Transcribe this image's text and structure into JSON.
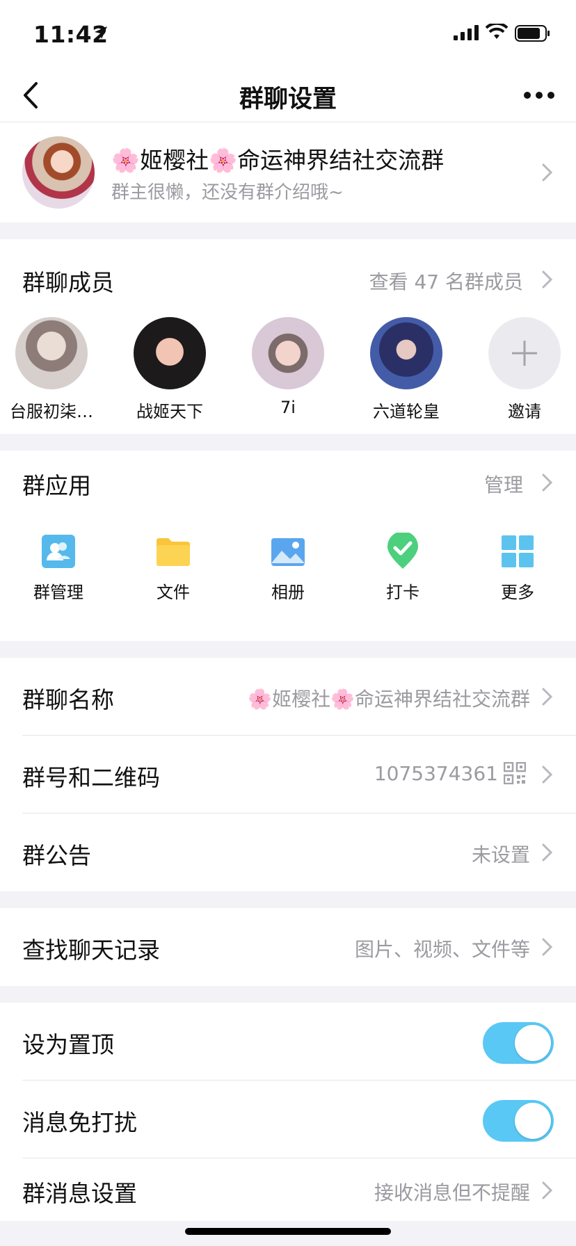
{
  "status_bar": {
    "time": "11:42"
  },
  "nav": {
    "title": "群聊设置"
  },
  "group": {
    "name": "🌸姬樱社🌸命运神界结社交流群",
    "description": "群主很懒，还没有群介绍哦~"
  },
  "members": {
    "title": "群聊成员",
    "view_all": "查看 47 名群成员",
    "list": [
      {
        "name": "台服初柒…"
      },
      {
        "name": "战姬天下"
      },
      {
        "name": "7i"
      },
      {
        "name": "六道轮皇"
      },
      {
        "name": "邀请"
      }
    ]
  },
  "apps": {
    "title": "群应用",
    "manage": "管理",
    "items": [
      {
        "label": "群管理",
        "icon": "group-manage-icon"
      },
      {
        "label": "文件",
        "icon": "folder-icon"
      },
      {
        "label": "相册",
        "icon": "photo-album-icon"
      },
      {
        "label": "打卡",
        "icon": "checkin-icon"
      },
      {
        "label": "更多",
        "icon": "more-apps-icon"
      }
    ]
  },
  "settings": {
    "group_name": {
      "label": "群聊名称",
      "value": "🌸姬樱社🌸命运神界结社交流群"
    },
    "group_id": {
      "label": "群号和二维码",
      "value": "1075374361"
    },
    "announcement": {
      "label": "群公告",
      "value": "未设置"
    },
    "search_history": {
      "label": "查找聊天记录",
      "value": "图片、视频、文件等"
    },
    "pin_top": {
      "label": "设为置顶",
      "on": true
    },
    "do_not_disturb": {
      "label": "消息免打扰",
      "on": true
    },
    "message_settings": {
      "label": "群消息设置",
      "value": "接收消息但不提醒"
    }
  },
  "colors": {
    "accent": "#5ac8f5",
    "secondary_text": "#9a9aa0",
    "background": "#f2f2f7"
  }
}
